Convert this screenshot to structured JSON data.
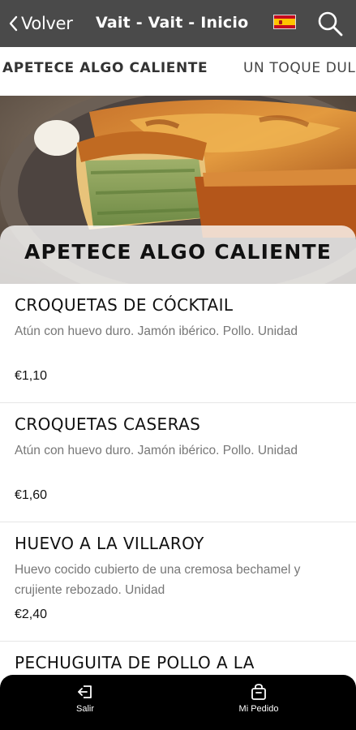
{
  "header": {
    "back_label": "Volver",
    "title": "Vait - Vait - Inicio",
    "language_flag": "spain-flag-icon",
    "search_icon": "search-icon",
    "background_color": "#4a4a4a"
  },
  "tabs": [
    {
      "label": "APETECE ALGO CALIENTE",
      "active": true
    },
    {
      "label": "UN TOQUE DUL",
      "active": false
    }
  ],
  "hero": {
    "image": "quiche-photo",
    "title": "APETECE ALGO CALIENTE"
  },
  "items": [
    {
      "name": "CROQUETAS DE CÓCKTAIL",
      "description": "Atún con huevo duro. Jamón ibérico. Pollo. Unidad",
      "price": "€1,10"
    },
    {
      "name": "CROQUETAS CASERAS",
      "description": "Atún con huevo duro. Jamón ibérico. Pollo. Unidad",
      "price": "€1,60"
    },
    {
      "name": "HUEVO A LA VILLAROY",
      "description": "Huevo cocido cubierto de una cremosa bechamel y crujiente rebozado. Unidad",
      "price": "€2,40"
    },
    {
      "name": "PECHUGUITA DE POLLO A LA",
      "description": "",
      "price": ""
    }
  ],
  "bottom_nav": {
    "exit_label": "Salir",
    "order_label": "Mi Pedido",
    "background_color": "#000000"
  }
}
